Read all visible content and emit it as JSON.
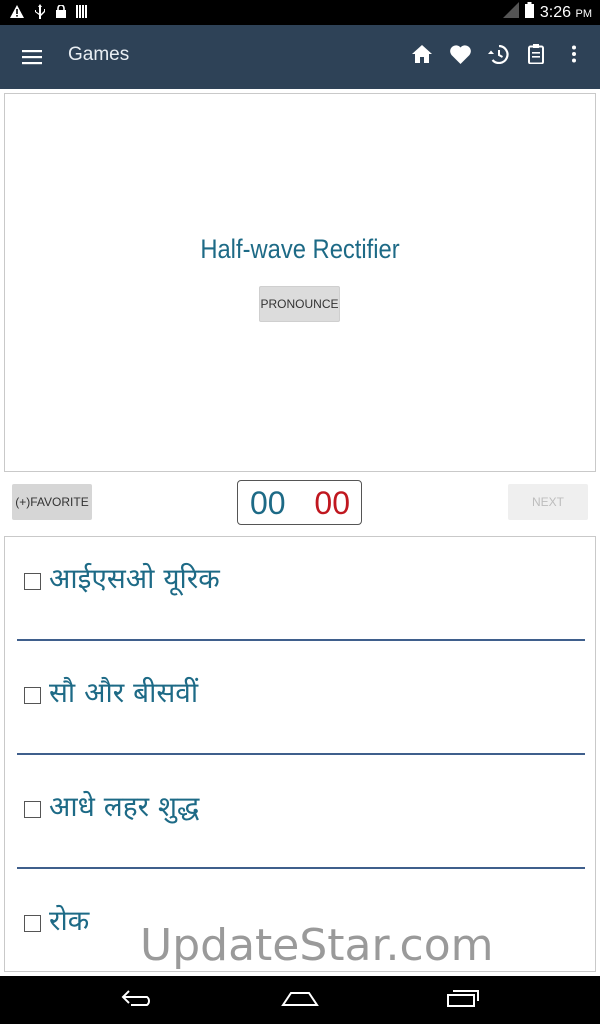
{
  "status_bar": {
    "time": "3:26",
    "ampm": "PM",
    "icons": [
      "warning-icon",
      "usb-icon",
      "lock-icon",
      "barcode-icon",
      "signal-icon",
      "battery-icon"
    ]
  },
  "app_bar": {
    "title": "Games",
    "actions": [
      "home-icon",
      "heart-icon",
      "history-icon",
      "clipboard-icon",
      "more-vert-icon"
    ]
  },
  "card": {
    "word": "Half-wave Rectifier",
    "pronounce_label": "PRONOUNCE"
  },
  "controls": {
    "favorite_label": "(+)FAVORITE",
    "score_correct": "00",
    "score_wrong": "00",
    "next_label": "NEXT"
  },
  "options": [
    {
      "label": "आईएसओ यूरिक"
    },
    {
      "label": "सौ और बीसवीं"
    },
    {
      "label": "आधे लहर शुद्ध"
    },
    {
      "label": "रोक"
    }
  ],
  "watermark": "UpdateStar.com",
  "colors": {
    "app_bar": "#2e4257",
    "accent_text": "#1d6a86",
    "wrong_score": "#c0171f",
    "divider": "#3f5f8c"
  }
}
